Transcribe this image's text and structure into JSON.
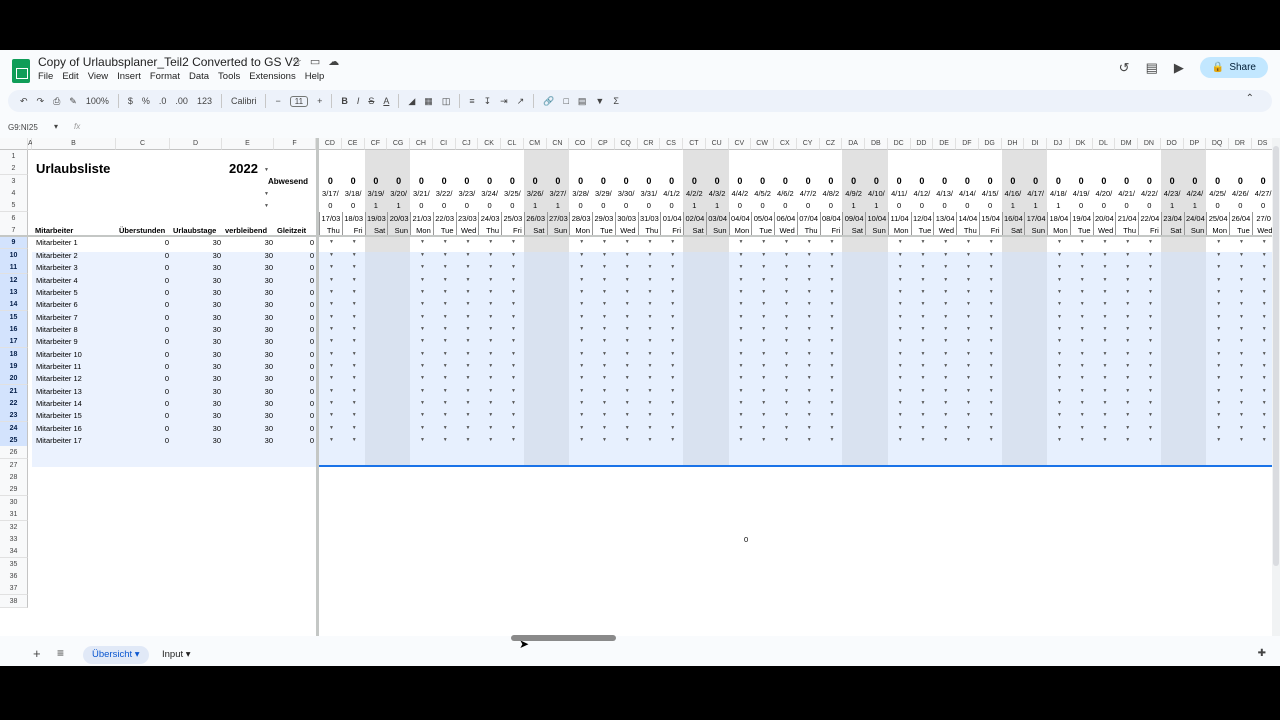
{
  "app": {
    "title": "Copy of Urlaubsplaner_Teil2 Converted to GS V2",
    "title_icons": [
      "☆",
      "▭",
      "☁"
    ],
    "menu": [
      "File",
      "Edit",
      "View",
      "Insert",
      "Format",
      "Data",
      "Tools",
      "Extensions",
      "Help"
    ],
    "share_label": "Share"
  },
  "toolbar": {
    "zoom": "100%",
    "currency": "$",
    "percent": "%",
    "dec_less": ".0",
    "dec_more": ".00",
    "format123": "123",
    "font": "Calibri",
    "font_size": "11",
    "minus": "−",
    "plus": "+",
    "bold": "B",
    "italic": "I",
    "strike": "S",
    "textcolor": "A",
    "sigma": "Σ"
  },
  "formula_bar": {
    "name_box": "G9:NI25",
    "fx": "fx"
  },
  "grid": {
    "left_headers": [
      "A",
      "B",
      "C",
      "D",
      "E",
      "F"
    ],
    "right_headers": [
      "CD",
      "CE",
      "CF",
      "CG",
      "CH",
      "CI",
      "CJ",
      "CK",
      "CL",
      "CM",
      "CN",
      "CO",
      "CP",
      "CQ",
      "CR",
      "CS",
      "CT",
      "CU",
      "CV",
      "CW",
      "CX",
      "CY",
      "CZ",
      "DA",
      "DB",
      "DC",
      "DD",
      "DE",
      "DF",
      "DG",
      "DH",
      "DI",
      "DJ",
      "DK",
      "DL",
      "DM",
      "DN",
      "DO",
      "DP",
      "DQ",
      "DR",
      "DS"
    ],
    "row_numbers": [
      "1",
      "2",
      "3",
      "4",
      "5",
      "6",
      "7",
      "9",
      "10",
      "11",
      "12",
      "13",
      "14",
      "15",
      "16",
      "17",
      "18",
      "19",
      "20",
      "21",
      "22",
      "23",
      "24",
      "25",
      "26",
      "27",
      "28",
      "29",
      "30",
      "31",
      "32",
      "33",
      "34",
      "35",
      "36",
      "37",
      "38"
    ],
    "title": "Urlaubsliste",
    "year": "2022",
    "abwesend": "Abwesend",
    "table_headers": [
      "Mitarbeiter",
      "Überstunden",
      "Urlaubstage",
      "verbleibend",
      "Gleitzeit"
    ],
    "employees": [
      "Mitarbeiter 1",
      "Mitarbeiter 2",
      "Mitarbeiter 3",
      "Mitarbeiter 4",
      "Mitarbeiter 5",
      "Mitarbeiter 6",
      "Mitarbeiter 7",
      "Mitarbeiter 8",
      "Mitarbeiter 9",
      "Mitarbeiter 10",
      "Mitarbeiter 11",
      "Mitarbeiter 12",
      "Mitarbeiter 13",
      "Mitarbeiter 14",
      "Mitarbeiter 15",
      "Mitarbeiter 16",
      "Mitarbeiter 17"
    ],
    "values": {
      "overtime": "0",
      "vacation": "30",
      "remaining": "30",
      "flextime": "0"
    },
    "abwesend_counts": [
      "0",
      "0",
      "0",
      "0",
      "0",
      "0",
      "0",
      "0",
      "0",
      "0",
      "0",
      "0",
      "0",
      "0",
      "0",
      "0",
      "0",
      "0",
      "0",
      "0",
      "0",
      "0",
      "0",
      "0",
      "0",
      "0",
      "0",
      "0",
      "0",
      "0",
      "0",
      "0",
      "0",
      "0",
      "0",
      "0",
      "0",
      "0",
      "0",
      "0",
      "0",
      "0"
    ],
    "dates_short": [
      "3/17/",
      "3/18/",
      "3/19/",
      "3/20/",
      "3/21/",
      "3/22/",
      "3/23/",
      "3/24/",
      "3/25/",
      "3/26/",
      "3/27/",
      "3/28/",
      "3/29/",
      "3/30/",
      "3/31/",
      "4/1/2",
      "4/2/2",
      "4/3/2",
      "4/4/2",
      "4/5/2",
      "4/6/2",
      "4/7/2",
      "4/8/2",
      "4/9/2",
      "4/10/",
      "4/11/",
      "4/12/",
      "4/13/",
      "4/14/",
      "4/15/",
      "4/16/",
      "4/17/",
      "4/18/",
      "4/19/",
      "4/20/",
      "4/21/",
      "4/22/",
      "4/23/",
      "4/24/",
      "4/25/",
      "4/26/",
      "4/27/"
    ],
    "weekend_flags": [
      "0",
      "0",
      "1",
      "1",
      "0",
      "0",
      "0",
      "0",
      "0",
      "1",
      "1",
      "0",
      "0",
      "0",
      "0",
      "0",
      "1",
      "1",
      "0",
      "0",
      "0",
      "0",
      "0",
      "1",
      "1",
      "0",
      "0",
      "0",
      "0",
      "0",
      "1",
      "1",
      "1",
      "0",
      "0",
      "0",
      "0",
      "1",
      "1",
      "0",
      "0",
      "0"
    ],
    "dates_day": [
      "17/03",
      "18/03",
      "19/03",
      "20/03",
      "21/03",
      "22/03",
      "23/03",
      "24/03",
      "25/03",
      "26/03",
      "27/03",
      "28/03",
      "29/03",
      "30/03",
      "31/03",
      "01/04",
      "02/04",
      "03/04",
      "04/04",
      "05/04",
      "06/04",
      "07/04",
      "08/04",
      "09/04",
      "10/04",
      "11/04",
      "12/04",
      "13/04",
      "14/04",
      "15/04",
      "16/04",
      "17/04",
      "18/04",
      "19/04",
      "20/04",
      "21/04",
      "22/04",
      "23/04",
      "24/04",
      "25/04",
      "26/04",
      "27/0"
    ],
    "weekdays": [
      "Thu",
      "Fri",
      "Sat",
      "Sun",
      "Mon",
      "Tue",
      "Wed",
      "Thu",
      "Fri",
      "Sat",
      "Sun",
      "Mon",
      "Tue",
      "Wed",
      "Thu",
      "Fri",
      "Sat",
      "Sun",
      "Mon",
      "Tue",
      "Wed",
      "Thu",
      "Fri",
      "Sat",
      "Sun",
      "Mon",
      "Tue",
      "Wed",
      "Thu",
      "Fri",
      "Sat",
      "Sun",
      "Mon",
      "Tue",
      "Wed",
      "Thu",
      "Fri",
      "Sat",
      "Sun",
      "Mon",
      "Tue",
      "Wed"
    ],
    "stray_value": "0"
  },
  "sheets": {
    "add": "+",
    "list": "≡",
    "tabs": [
      "Übersicht",
      "Input"
    ]
  },
  "colors": {
    "accent": "#1a73e8",
    "selection": "#d3e3fd",
    "share": "#c2e7ff",
    "weekend": "#c8c8c8"
  }
}
